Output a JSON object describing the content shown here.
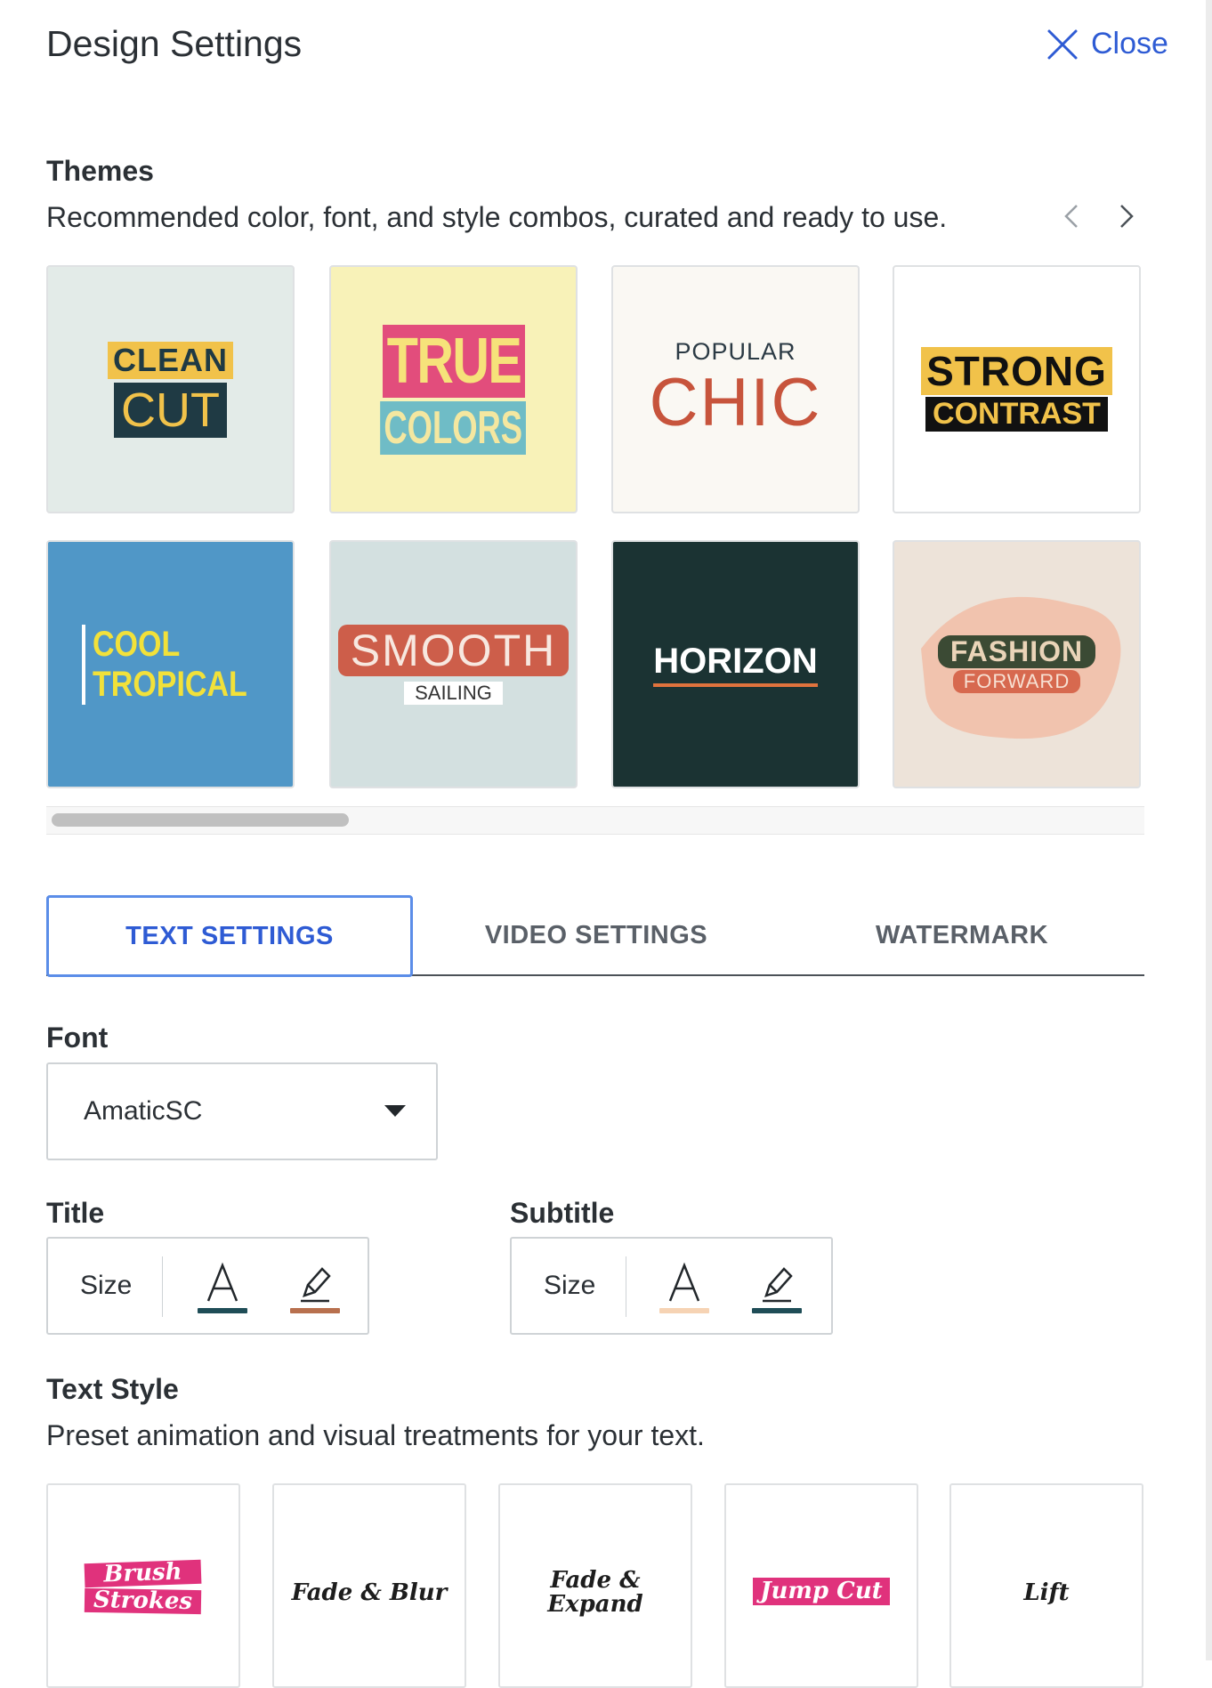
{
  "header": {
    "title": "Design Settings",
    "close_label": "Close"
  },
  "themes": {
    "title": "Themes",
    "description": "Recommended color, font, and style combos, curated and ready to use.",
    "cards": [
      {
        "line1": "CLEAN",
        "line2": "CUT"
      },
      {
        "line1": "TRUE",
        "line2": "COLORS"
      },
      {
        "line1": "POPULAR",
        "line2": "CHIC"
      },
      {
        "line1": "STRONG",
        "line2": "CONTRAST"
      },
      {
        "line1": "COOL",
        "line2": "TROPICAL"
      },
      {
        "line1": "SMOOTH",
        "line2": "SAILING"
      },
      {
        "line1": "HORIZON"
      },
      {
        "line1": "FASHION",
        "line2": "FORWARD"
      }
    ]
  },
  "tabs": [
    {
      "label": "TEXT SETTINGS"
    },
    {
      "label": "VIDEO SETTINGS"
    },
    {
      "label": "WATERMARK"
    }
  ],
  "text_settings": {
    "font_label": "Font",
    "font_value": "AmaticSC",
    "title_label": "Title",
    "subtitle_label": "Subtitle",
    "size_label": "Size",
    "title_text_color": "#1f4d57",
    "title_highlight_color": "#b8704e",
    "subtitle_text_color": "#f6d3b4",
    "subtitle_highlight_color": "#1f4d57"
  },
  "text_style": {
    "title": "Text Style",
    "description": "Preset animation and visual treatments for your text.",
    "cards": [
      {
        "line1": "Brush",
        "line2": "Strokes"
      },
      {
        "line1": "Fade & Blur"
      },
      {
        "line1": "Fade &",
        "line2": "Expand"
      },
      {
        "line1": "Jump Cut"
      },
      {
        "line1": "Lift"
      }
    ]
  }
}
